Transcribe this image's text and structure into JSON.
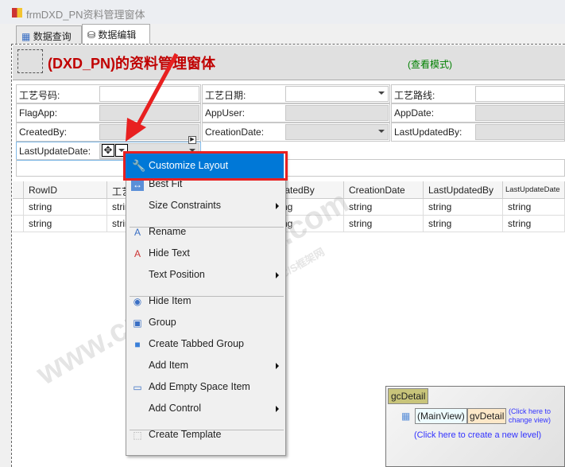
{
  "window": {
    "title": "frmDXD_PN资料管理窗体"
  },
  "tabs": [
    {
      "label": "数据查询"
    },
    {
      "label": "数据编辑",
      "active": true
    }
  ],
  "header": {
    "title": "(DXD_PN)的资料管理窗体",
    "mode": "(查看模式)"
  },
  "form": {
    "r1": [
      "工艺号码:",
      "工艺日期:",
      "工艺路线:"
    ],
    "r2": [
      "FlagApp:",
      "AppUser:",
      "AppDate:"
    ],
    "r3": [
      "CreatedBy:",
      "CreationDate:",
      "LastUpdatedBy:"
    ],
    "r4": [
      "LastUpdateDate:"
    ]
  },
  "grid": {
    "columns": [
      "RowID",
      "工艺",
      "",
      "CreatedBy",
      "CreationDate",
      "LastUpdatedBy",
      "LastUpdateDate"
    ],
    "rows": [
      [
        "string",
        "string",
        "",
        "string",
        "string",
        "string",
        "string"
      ],
      [
        "string",
        "string",
        "",
        "string",
        "string",
        "string",
        "string"
      ]
    ]
  },
  "menu": {
    "items": [
      {
        "label": "Customize Layout",
        "icon": "wrench-icon",
        "highlighted": true
      },
      {
        "label": "Best Fit",
        "icon": "best-fit-icon"
      },
      {
        "label": "Size Constraints",
        "submenu": true
      },
      {
        "label": "Rename",
        "icon": "rename-icon"
      },
      {
        "label": "Hide Text",
        "icon": "hide-text-icon"
      },
      {
        "label": "Text Position",
        "submenu": true
      },
      {
        "label": "Hide Item",
        "icon": "hide-eye-icon"
      },
      {
        "label": "Group",
        "icon": "group-icon"
      },
      {
        "label": "Create Tabbed Group",
        "icon": "folder-icon"
      },
      {
        "label": "Add Item",
        "submenu": true
      },
      {
        "label": "Add Empty Space Item",
        "icon": "empty-space-icon"
      },
      {
        "label": "Add Control",
        "submenu": true
      },
      {
        "label": "Create Template",
        "icon": "template-icon"
      }
    ]
  },
  "detail": {
    "name": "gcDetail",
    "mainview": "(MainView)",
    "view": "gvDetail",
    "change_link": "(Click here to change view)",
    "new_level": "(Click here to create a new level)"
  },
  "watermark": {
    "url": "www.cnframework.com",
    "site": "C/S框架网"
  },
  "colors": {
    "accent": "#0078d7",
    "title_red": "#c00000",
    "mode_green": "#008000",
    "highlight_border": "#e82020",
    "link": "#3333ff"
  }
}
